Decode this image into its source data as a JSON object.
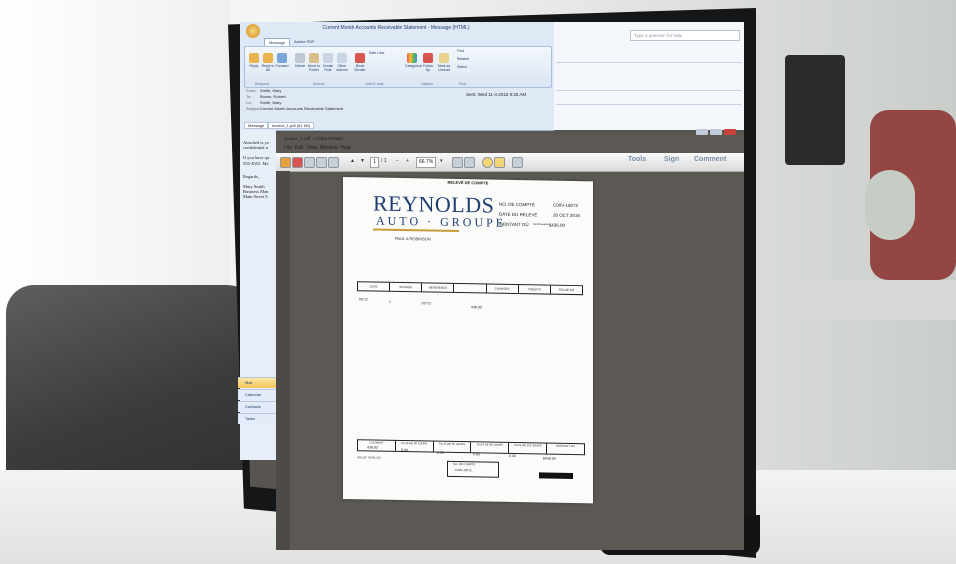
{
  "outlook": {
    "window_title": "Current Month Accounts Receivable Statement - Message (HTML)",
    "tabs": [
      "Message",
      "Adobe PDF"
    ],
    "ribbon": {
      "buttons": [
        "Reply",
        "Reply to All",
        "Forward",
        "Delete",
        "Move to Folder",
        "Create Rule",
        "Other Actions",
        "Block Sender",
        "Safe Lists",
        "Categorize",
        "Follow Up",
        "Mark as Unread",
        "Find",
        "Related",
        "Select"
      ],
      "groups": [
        "Respond",
        "Actions",
        "Junk E-mail",
        "Options",
        "Find"
      ]
    },
    "header": {
      "from_label": "From:",
      "from": "Smith, Mary",
      "to_label": "To:",
      "to": "Brown, Robert",
      "cc_label": "Cc:",
      "cc": "Smith, Mary",
      "subject_label": "Subject:",
      "subject": "Current Month Accounts Receivable Statement"
    },
    "sent_label": "Sent:",
    "sent": "Wed 11-4-2015 9:25 AM",
    "attachment_tab": "Message",
    "attachment_file": "invoice_1.pdf (61 KB)",
    "search_placeholder": "Type a question for help",
    "body_lines": [
      "Attached is yo",
      "confidential n",
      "",
      "If you have qu",
      "555-4555. Ma",
      "",
      "Regards,",
      "",
      "Mary Smith",
      "Business Man",
      "Main Street S"
    ],
    "nav": [
      "Mail",
      "Calendar",
      "Contacts",
      "Tasks"
    ]
  },
  "reader": {
    "title": "invoice_1.pdf - Adobe Reader",
    "menu": [
      "File",
      "Edit",
      "View",
      "Window",
      "Help"
    ],
    "page_current": "1",
    "page_total": "/ 1",
    "zoom": "66.7%",
    "right_buttons": [
      "Tools",
      "Sign",
      "Comment"
    ]
  },
  "pdf": {
    "title": "RELEVÉ DE COMPTE",
    "logo_top": "REYNOLDS",
    "logo_bottom": "AUTO · GROUPE",
    "customer": "PAUL A ROBINSON",
    "fields": [
      {
        "label": "NO. DE COMPTE",
        "value": "C00V-18072"
      },
      {
        "label": "DATE DU RELEVÉ",
        "value": "20 OCT 2016"
      },
      {
        "label": "MONTANT DÛ",
        "value": "*********$436.00"
      }
    ],
    "table_headers": [
      "DATE",
      "SOURCE",
      "RÉFÉRENCE",
      "",
      "CHARGES",
      "CRÉDITS",
      "SOLDE DÛ"
    ],
    "row": {
      "date": "09-12",
      "source": "1",
      "reference": "70773",
      "charges": "436.00"
    },
    "footer_headers": [
      "COURANT",
      "PLUS DE 30 JOURS",
      "PLUS DE 60 JOURS",
      "PLUS DE 90 JOURS",
      "PLUS DE 120 JOURS",
      "MONTANT DÛ"
    ],
    "footer_values": [
      "436.00",
      "0.00",
      "0.00",
      "0.00",
      "0.00",
      "$436.00"
    ],
    "footer_label": "SOLDE TOTAL DÛ",
    "account_label": "NO. DE COMPTE",
    "account_value": "C00V-18072"
  }
}
